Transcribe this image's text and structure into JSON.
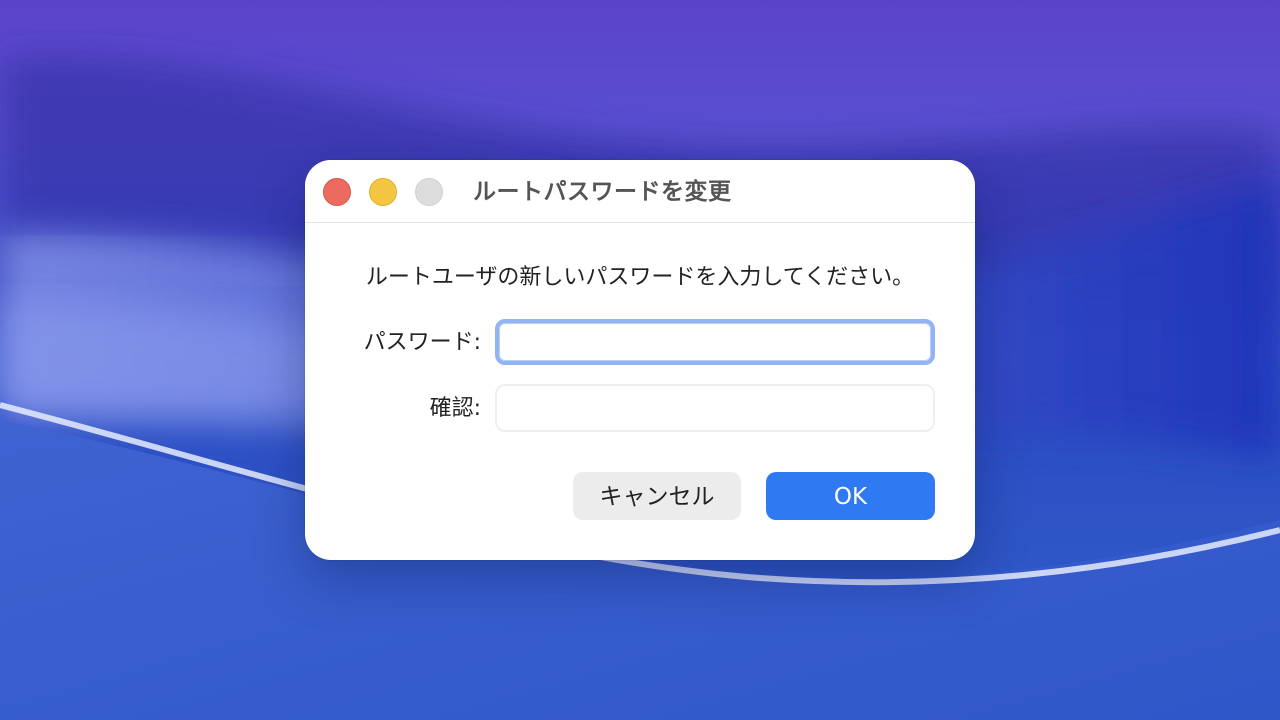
{
  "dialog": {
    "title": "ルートパスワードを変更",
    "message": "ルートユーザの新しいパスワードを入力してください。",
    "fields": {
      "password_label": "パスワード:",
      "password_value": "",
      "confirm_label": "確認:",
      "confirm_value": ""
    },
    "buttons": {
      "cancel_label": "キャンセル",
      "ok_label": "OK"
    }
  },
  "colors": {
    "accent": "#2f7af2",
    "close": "#ec6a5f",
    "minimize": "#f4c541",
    "zoom_disabled": "#dddddd",
    "focus_ring": "#93b4f4"
  },
  "icons": {
    "close": "close-window-icon",
    "minimize": "minimize-window-icon",
    "zoom": "zoom-window-icon"
  }
}
